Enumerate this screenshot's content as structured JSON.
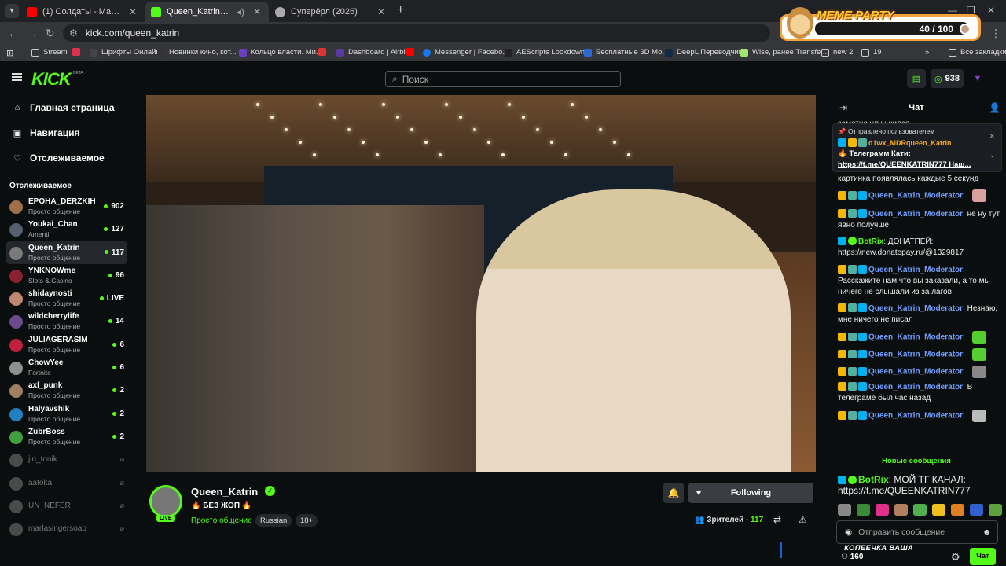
{
  "browser": {
    "tabs": [
      {
        "title": "(1) Солдаты - Марш \"Юность В...",
        "icon_color": "#ff0000",
        "icon": "youtube-icon"
      },
      {
        "title": "Queen_Katrin Stream - Watch...",
        "icon_color": "#53fc18",
        "icon": "kick-icon"
      },
      {
        "title": "Суперёрл (2026)",
        "icon_color": "#aaaaaa",
        "icon": "globe-icon"
      }
    ],
    "url": "kick.com/queen_katrin",
    "bookmarks": [
      "Stream",
      "Шрифты Онлайн",
      "Новинки кино, кот...",
      "Кольцо власти. Ми...",
      "Dashboard | Airbit",
      "Messenger | Facebo...",
      "AEScripts Lockdown...",
      "Бесплатные 3D Мо...",
      "DeepL Переводчик",
      "Wise, ранее Transfe...",
      "new 2",
      "19"
    ],
    "all_bookmarks": "Все закладки"
  },
  "overlay": {
    "title": "MEME PARTY",
    "score": "40 / 100",
    "bottom_text": "КОПЕЕЧКА ВАША"
  },
  "topnav": {
    "logo": "KICK",
    "beta": "BETA",
    "search_placeholder": "Поиск",
    "points": "938"
  },
  "sidebar": {
    "nav": [
      {
        "label": "Главная страница",
        "icon": "home-icon"
      },
      {
        "label": "Навигация",
        "icon": "browse-icon"
      },
      {
        "label": "Отслеживаемое",
        "icon": "heart-icon"
      }
    ],
    "following_header": "Отслеживаемое",
    "channels": [
      {
        "name": "EPOHA_DERZKIH",
        "category": "Просто общение",
        "viewers": "902",
        "color": "#a0704a"
      },
      {
        "name": "Youkai_Chan",
        "category": "Amenti",
        "viewers": "127",
        "color": "#556070"
      },
      {
        "name": "Queen_Katrin",
        "category": "Просто общение",
        "viewers": "117",
        "color": "#7a7a7a"
      },
      {
        "name": "YNKNOWme",
        "category": "Slots & Casino",
        "viewers": "96",
        "color": "#8a2030"
      },
      {
        "name": "shidaynosti",
        "category": "Просто общение",
        "viewers": "LIVE",
        "color": "#c08870"
      },
      {
        "name": "wildcherrylife",
        "category": "Просто общение",
        "viewers": "14",
        "color": "#6a4a8a"
      },
      {
        "name": "JULIAGERASIM",
        "category": "Просто общение",
        "viewers": "6",
        "color": "#c02040"
      },
      {
        "name": "ChowYee",
        "category": "Fortnite",
        "viewers": "6",
        "color": "#909090"
      },
      {
        "name": "axl_punk",
        "category": "Просто общение",
        "viewers": "2",
        "color": "#a08060"
      },
      {
        "name": "Halyavshik",
        "category": "Просто общение",
        "viewers": "2",
        "color": "#2080c0"
      },
      {
        "name": "ZubrBoss",
        "category": "Просто общение",
        "viewers": "2",
        "color": "#40a040"
      }
    ],
    "offline": [
      {
        "name": "jin_tonik"
      },
      {
        "name": "aatoka"
      },
      {
        "name": "UN_NEFER"
      },
      {
        "name": "marlasingersoap"
      }
    ]
  },
  "stream": {
    "name": "Queen_Katrin",
    "live": "LIVE",
    "title": "🔥 БЕЗ ЖОП 🔥",
    "category": "Просто общение",
    "tags": [
      "Russian",
      "18+"
    ],
    "follow_label": "Following",
    "viewers_label": "Зрителей -",
    "viewers": "117"
  },
  "chat": {
    "title": "Чат",
    "top_cut": "заметно улучшился",
    "pinned": {
      "header": "Отправлено пользователем",
      "user": "d1wx_MDRqueen_Katrin",
      "message": "🔥 Телеграмм Кати:",
      "link": "https://t.me/QUEENKATRIN777 Наш..."
    },
    "messages": [
      {
        "user": "",
        "text": "картинка появлялась каждые 5 секунд",
        "badges": []
      },
      {
        "user": "Queen_Katrin_Moderator",
        "text": "",
        "badges": [
          "crown",
          "vip",
          "mod"
        ],
        "emote": "#d9a0a0"
      },
      {
        "user": "Queen_Katrin_Moderator",
        "text": "не ну тут явно получше",
        "badges": [
          "crown",
          "vip",
          "mod"
        ]
      },
      {
        "user": "BotRix",
        "text": "ДОНАТПЕЙ: https://new.donatepay.ru/@1329817",
        "badges": [
          "mod",
          "bot"
        ],
        "bot": true
      },
      {
        "user": "Queen_Katrin_Moderator",
        "text": "Расскажите нам что вы заказали, а то мы ничего не слышали из за лагов",
        "badges": [
          "crown",
          "vip",
          "mod"
        ]
      },
      {
        "user": "Queen_Katrin_Moderator",
        "text": "Незнаю, мне ничего не писал",
        "badges": [
          "crown",
          "vip",
          "mod"
        ]
      },
      {
        "user": "Queen_Katrin_Moderator",
        "text": "",
        "badges": [
          "crown",
          "vip",
          "mod"
        ],
        "emote": "#53d030"
      },
      {
        "user": "Queen_Katrin_Moderator",
        "text": "",
        "badges": [
          "crown",
          "vip",
          "mod"
        ],
        "emote": "#53d030"
      },
      {
        "user": "Queen_Katrin_Moderator",
        "text": "",
        "badges": [
          "crown",
          "vip",
          "mod"
        ],
        "emote": "#888888"
      },
      {
        "user": "Queen_Katrin_Moderator",
        "text": "В телеграме был час назад",
        "badges": [
          "crown",
          "vip",
          "mod"
        ]
      },
      {
        "user": "Queen_Katrin_Moderator",
        "text": "",
        "badges": [
          "crown",
          "vip",
          "mod"
        ],
        "emote": "#bbbbbb"
      }
    ],
    "new_messages": "Новые сообщения",
    "after": {
      "user": "BotRix",
      "text": "МОЙ ТГ КАНАЛ: https://t.me/QUEENKATRIN777"
    },
    "emotes": [
      "#888888",
      "#3a8a3a",
      "#e0308a",
      "#b08060",
      "#50b050",
      "#f0c020",
      "#e08020",
      "#3060d0",
      "#60a040"
    ],
    "input_placeholder": "Отправить сообщение",
    "points": "160",
    "send_label": "Чат"
  }
}
